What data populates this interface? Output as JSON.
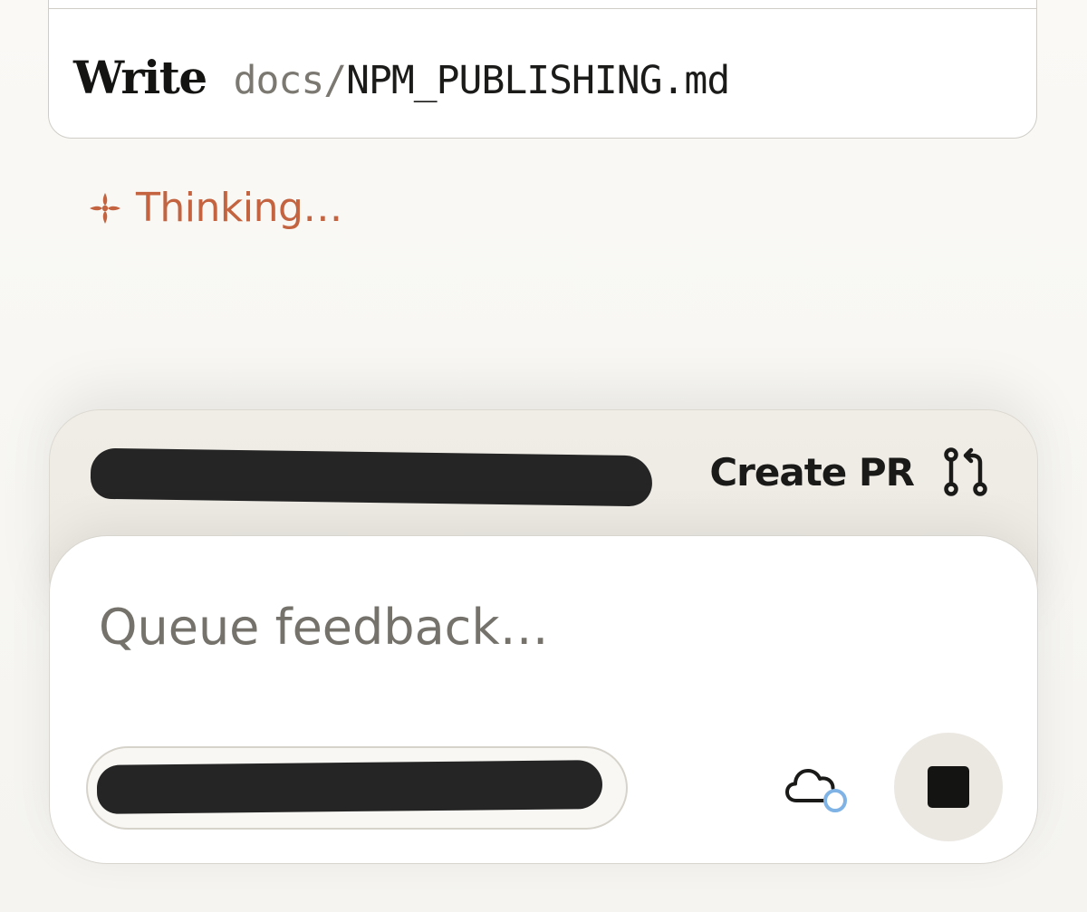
{
  "tool_call": {
    "verb": "Write",
    "path_dir": "docs/",
    "path_file": "NPM_PUBLISHING.md"
  },
  "status": {
    "thinking_text": "Thinking…"
  },
  "branch_bar": {
    "create_pr_label": "Create PR"
  },
  "composer": {
    "placeholder": "Queue feedback…"
  },
  "colors": {
    "accent": "#c4633f",
    "background": "#f8f7f3",
    "text": "#141413"
  },
  "icons": {
    "thinking": "sparkle-icon",
    "pull_request": "git-pull-request-icon",
    "cloud": "cloud-status-icon",
    "stop": "stop-icon"
  }
}
